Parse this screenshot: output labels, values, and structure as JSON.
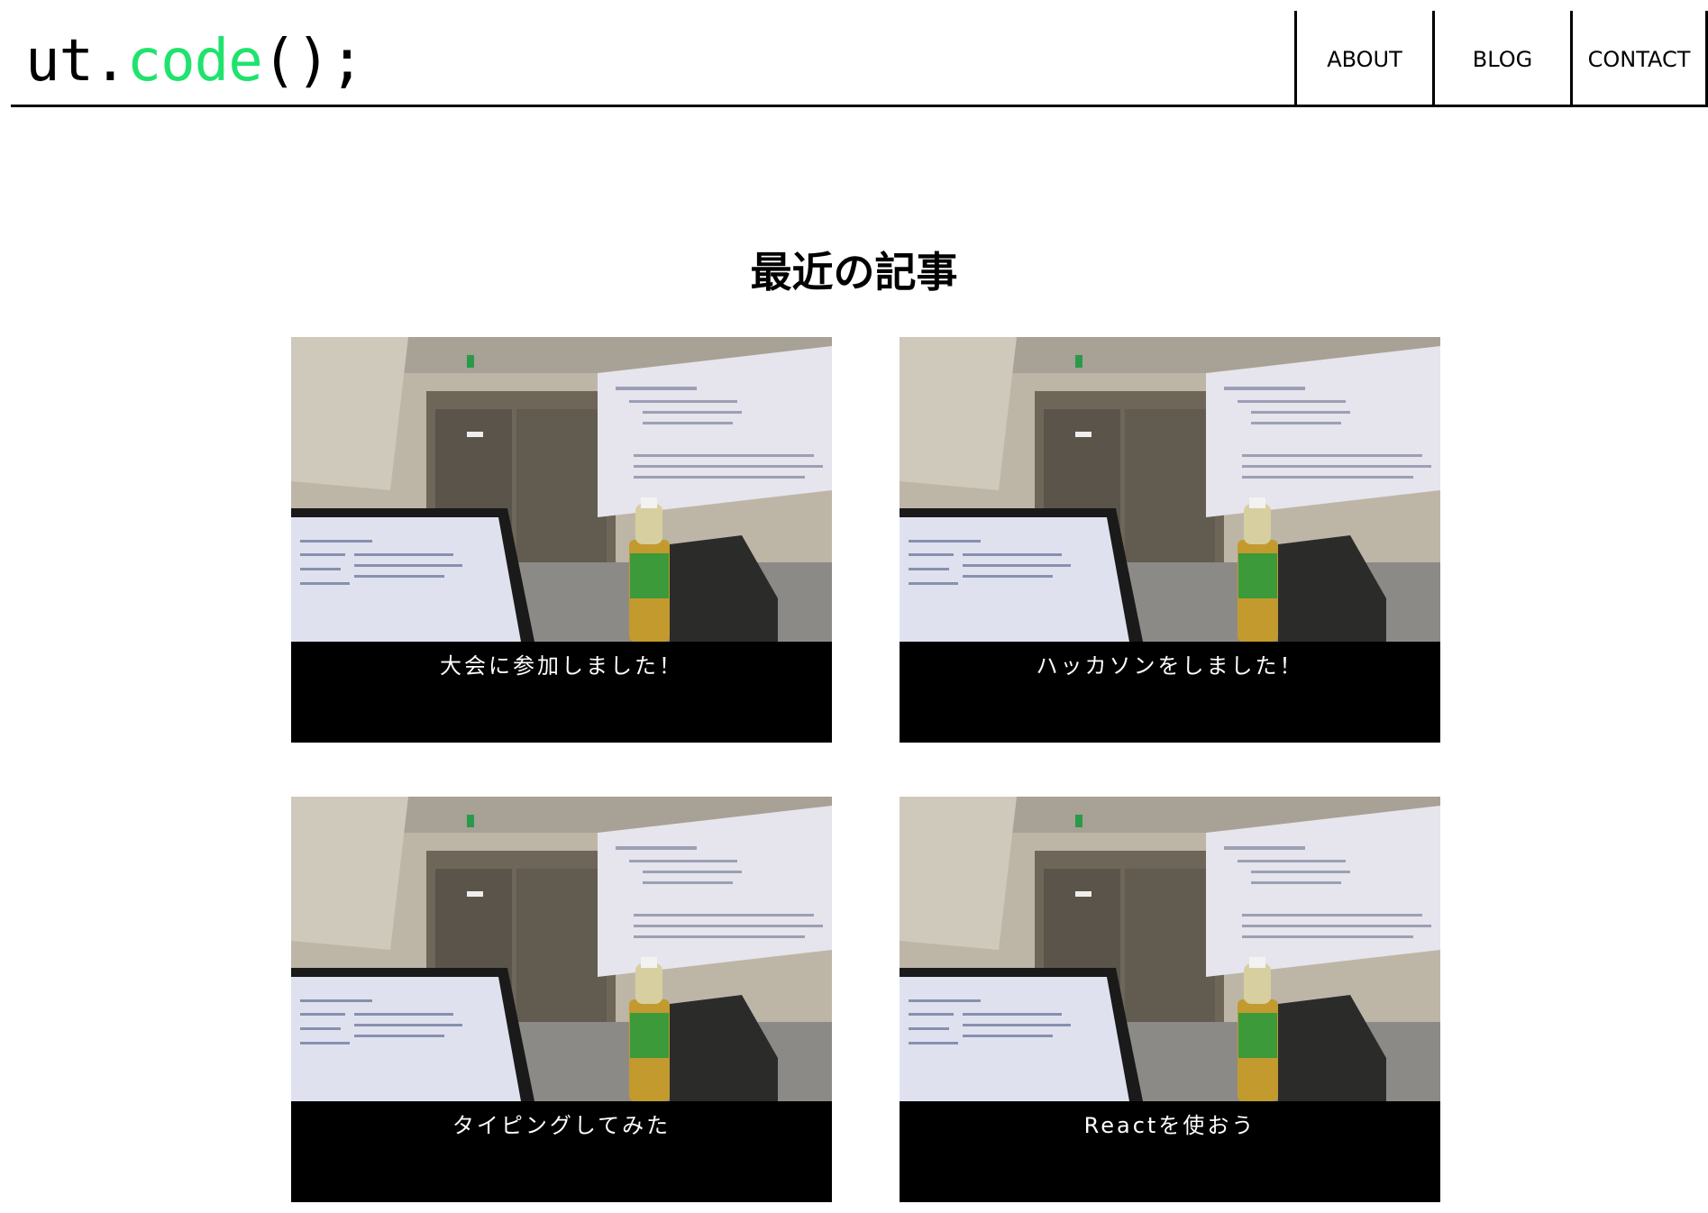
{
  "header": {
    "logo": {
      "part1": "ut.",
      "part2": "code",
      "part3": "();"
    },
    "nav": [
      {
        "label": "ABOUT"
      },
      {
        "label": "BLOG"
      },
      {
        "label": "CONTACT"
      }
    ]
  },
  "main": {
    "section_title": "最近の記事",
    "articles": [
      {
        "title": "大会に参加しました！"
      },
      {
        "title": "ハッカソンをしました！"
      },
      {
        "title": "タイピングしてみた"
      },
      {
        "title": "Reactを使おう"
      }
    ]
  },
  "colors": {
    "accent": "#1fe36d",
    "caption_bg": "#000000",
    "caption_text": "#ffffff"
  }
}
